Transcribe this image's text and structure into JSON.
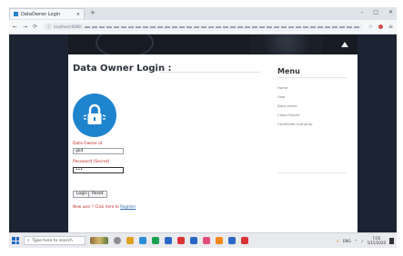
{
  "browser": {
    "tab_title": "DataOwner Login",
    "tab_close": "×",
    "new_tab": "+",
    "window_buttons": [
      "–",
      "□",
      "✕"
    ],
    "nav_buttons": [
      "←",
      "→",
      "⟳"
    ],
    "url_text": "localhost:8080/",
    "right_icons": [
      "☆",
      "≡"
    ]
  },
  "page": {
    "title": "Data Owner Login :",
    "lock_icon": "lock-icon",
    "lock_color": "#1f84ce",
    "form": {
      "owner_label": "Data Owner id",
      "owner_value": "gkd",
      "password_label": "Password (Secret)",
      "password_value": "•••",
      "login_label": "Login",
      "reset_label": "Reset",
      "newuser_text": "New user ? Click here to",
      "register_link": "Register"
    },
    "menu": {
      "title": "Menu",
      "items": [
        "Home",
        "User",
        "Data owner",
        "Cloud Server",
        "Certificate Authority"
      ]
    }
  },
  "taskbar": {
    "search_text": "Type here to search",
    "tray_text": "ENG",
    "time": "7:05",
    "date": "5/15/2020"
  },
  "colors": {
    "accent": "#1f84ce",
    "error_red": "#c62828",
    "link_blue": "#2b6cb0",
    "page_dark": "#1c2433"
  }
}
